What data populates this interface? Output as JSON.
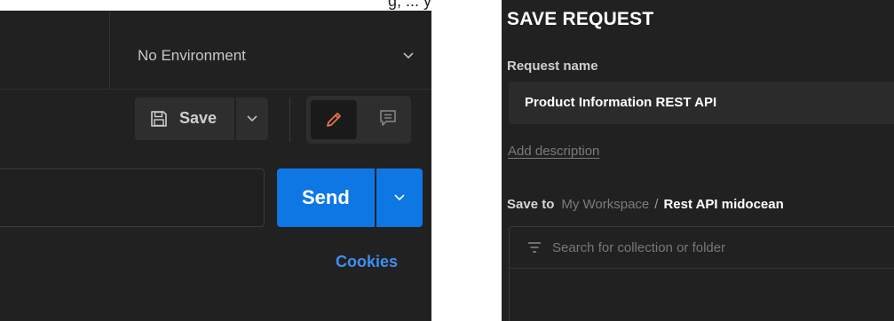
{
  "caption": {
    "text": "g, ... y"
  },
  "request_toolbar": {
    "environment": {
      "selected": "No Environment",
      "chevron_icon": "chevron-down-icon"
    },
    "save_button": {
      "label": "Save",
      "icon": "floppy-disk-icon"
    },
    "save_dropdown_icon": "chevron-down-icon",
    "mode_toggle": {
      "active": "edit",
      "edit_icon": "pencil-icon",
      "comment_icon": "comment-icon"
    },
    "url_input": {
      "value": ""
    },
    "send_button": {
      "label": "Send"
    },
    "send_dropdown_icon": "chevron-down-icon",
    "cookies_link": "Cookies"
  },
  "save_request_dialog": {
    "title": "SAVE REQUEST",
    "request_name": {
      "label": "Request name",
      "value": "Product Information REST API"
    },
    "add_description_link": "Add description",
    "save_to": {
      "label": "Save to",
      "breadcrumb": [
        "My Workspace",
        "Rest API midocean"
      ],
      "separator": "/"
    },
    "collection_search": {
      "placeholder": "Search for collection or folder",
      "icon": "filter-icon"
    }
  },
  "colors": {
    "background": "#212121",
    "send_blue": "#0d78e4",
    "link_blue": "#3d8ff0",
    "edit_accent": "#e8734a"
  }
}
